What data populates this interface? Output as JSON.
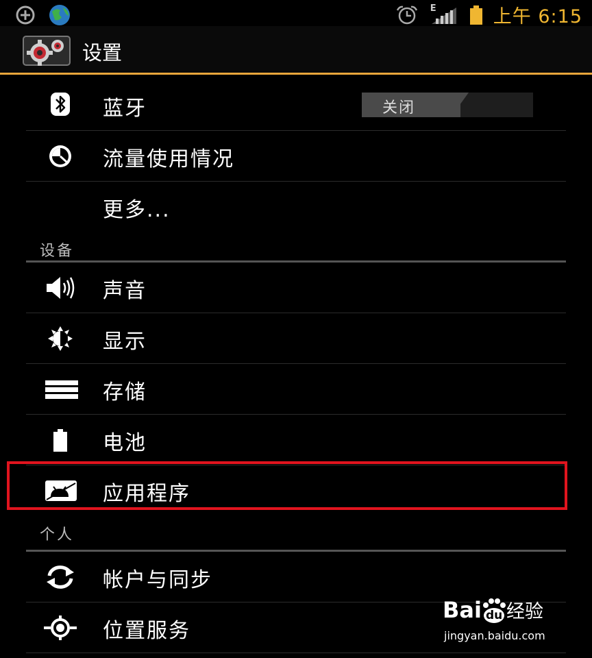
{
  "status_bar": {
    "time": "上午 6:15",
    "network_type": "E",
    "accent_color": "#f0b631",
    "icons": [
      "add-circle-icon",
      "globe-icon",
      "alarm-icon",
      "signal-icon",
      "battery-icon"
    ]
  },
  "action_bar": {
    "title": "设置",
    "icon": "settings-gear-icon",
    "divider_color": "#e8a53b"
  },
  "wireless": {
    "bluetooth": {
      "label": "蓝牙",
      "icon": "bluetooth-icon",
      "toggle": "关闭"
    },
    "data_usage": {
      "label": "流量使用情况",
      "icon": "data-usage-icon"
    },
    "more": {
      "label": "更多..."
    }
  },
  "device": {
    "header": "设备",
    "items": [
      {
        "label": "声音",
        "icon": "sound-icon"
      },
      {
        "label": "显示",
        "icon": "display-icon"
      },
      {
        "label": "存储",
        "icon": "storage-icon"
      },
      {
        "label": "电池",
        "icon": "battery-icon"
      },
      {
        "label": "应用程序",
        "icon": "apps-icon"
      }
    ]
  },
  "personal": {
    "header": "个人",
    "items": [
      {
        "label": "帐户与同步",
        "icon": "sync-icon"
      },
      {
        "label": "位置服务",
        "icon": "location-icon"
      }
    ]
  },
  "annotation": {
    "highlight_color": "#e0141e",
    "highlighted_item": "应用程序"
  },
  "watermark": {
    "brand": "Bai",
    "brand_paw": "du",
    "suffix": "经验",
    "url": "jingyan.baidu.com"
  }
}
